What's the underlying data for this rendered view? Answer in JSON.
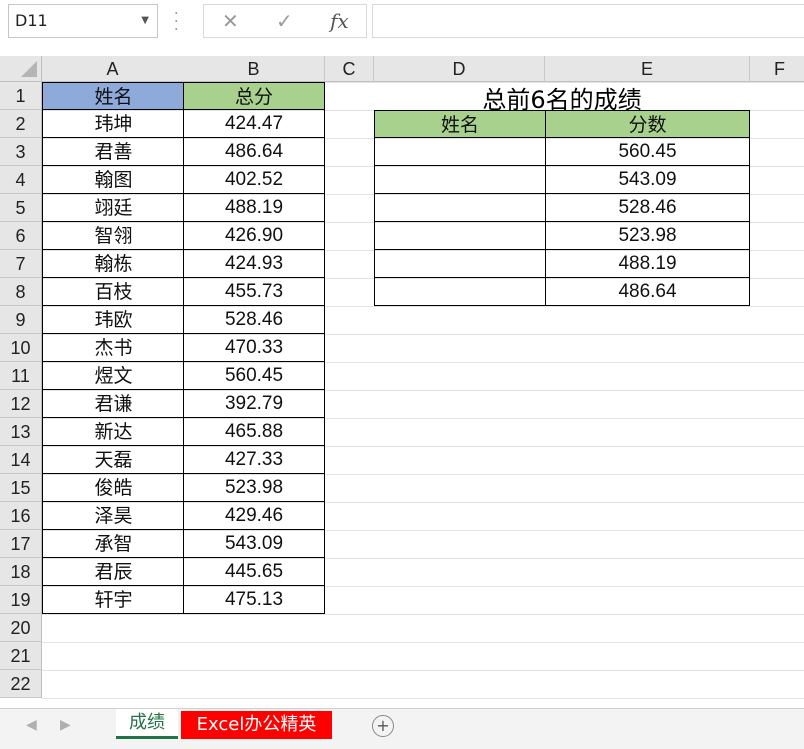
{
  "formula_bar": {
    "name_box": "D11",
    "cancel_glyph": "✕",
    "confirm_glyph": "✓",
    "fx_label": "fx",
    "formula": ""
  },
  "columns": [
    "A",
    "B",
    "C",
    "D",
    "E",
    "F"
  ],
  "rows": [
    "1",
    "2",
    "3",
    "4",
    "5",
    "6",
    "7",
    "8",
    "9",
    "10",
    "11",
    "12",
    "13",
    "14",
    "15",
    "16",
    "17",
    "18",
    "19",
    "20",
    "21",
    "22"
  ],
  "source_table": {
    "header_name": "姓名",
    "header_score": "总分",
    "records": [
      {
        "name": "玮坤",
        "score": "424.47"
      },
      {
        "name": "君善",
        "score": "486.64"
      },
      {
        "name": "翰图",
        "score": "402.52"
      },
      {
        "name": "翊廷",
        "score": "488.19"
      },
      {
        "name": "智翎",
        "score": "426.90"
      },
      {
        "name": "翰栋",
        "score": "424.93"
      },
      {
        "name": "百枝",
        "score": "455.73"
      },
      {
        "name": "玮欧",
        "score": "528.46"
      },
      {
        "name": "杰书",
        "score": "470.33"
      },
      {
        "name": "煜文",
        "score": "560.45"
      },
      {
        "name": "君谦",
        "score": "392.79"
      },
      {
        "name": "新达",
        "score": "465.88"
      },
      {
        "name": "天磊",
        "score": "427.33"
      },
      {
        "name": "俊皓",
        "score": "523.98"
      },
      {
        "name": "泽昊",
        "score": "429.46"
      },
      {
        "name": "承智",
        "score": "543.09"
      },
      {
        "name": "君辰",
        "score": "445.65"
      },
      {
        "name": "轩宇",
        "score": "475.13"
      }
    ]
  },
  "top_table": {
    "title": "总前6名的成绩",
    "header_name": "姓名",
    "header_score": "分数",
    "records": [
      {
        "name": "",
        "score": "560.45"
      },
      {
        "name": "",
        "score": "543.09"
      },
      {
        "name": "",
        "score": "528.46"
      },
      {
        "name": "",
        "score": "523.98"
      },
      {
        "name": "",
        "score": "488.19"
      },
      {
        "name": "",
        "score": "486.64"
      }
    ]
  },
  "sheet_tabs": {
    "active": "成绩",
    "other": "Excel办公精英",
    "prev_glyph": "◀",
    "next_glyph": "▶",
    "add_glyph": "+"
  },
  "colors": {
    "header_blue": "#8eaadb",
    "header_green": "#a9d18e",
    "tab_red": "#ff0000",
    "excel_green": "#217346"
  }
}
